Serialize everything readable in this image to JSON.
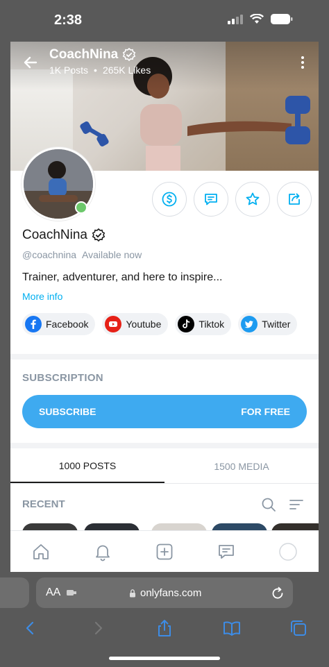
{
  "status_bar": {
    "time": "2:38"
  },
  "profile": {
    "name": "CoachNina",
    "posts_stat": "1K Posts",
    "likes_stat": "265K Likes",
    "handle": "@coachnina",
    "availability": "Available now",
    "bio": "Trainer, adventurer, and here to inspire...",
    "more_info": "More info"
  },
  "socials": [
    {
      "label": "Facebook",
      "icon": "facebook-icon",
      "color": "#1877f2"
    },
    {
      "label": "Youtube",
      "icon": "youtube-icon",
      "color": "#e62117"
    },
    {
      "label": "Tiktok",
      "icon": "tiktok-icon",
      "color": "#000000"
    },
    {
      "label": "Twitter",
      "icon": "twitter-icon",
      "color": "#1d9bf0"
    }
  ],
  "subscription": {
    "section_title": "SUBSCRIPTION",
    "button_left": "SUBSCRIBE",
    "button_right": "FOR FREE"
  },
  "tabs": [
    {
      "label": "1000 POSTS",
      "active": true
    },
    {
      "label": "1500 MEDIA",
      "active": false
    }
  ],
  "recent": {
    "label": "RECENT"
  },
  "browser": {
    "text_size": "AA",
    "url": "onlyfans.com"
  },
  "colors": {
    "accent": "#00aff0",
    "button": "#3eaaf0",
    "online": "#6cc86b",
    "muted": "#8a96a3"
  }
}
